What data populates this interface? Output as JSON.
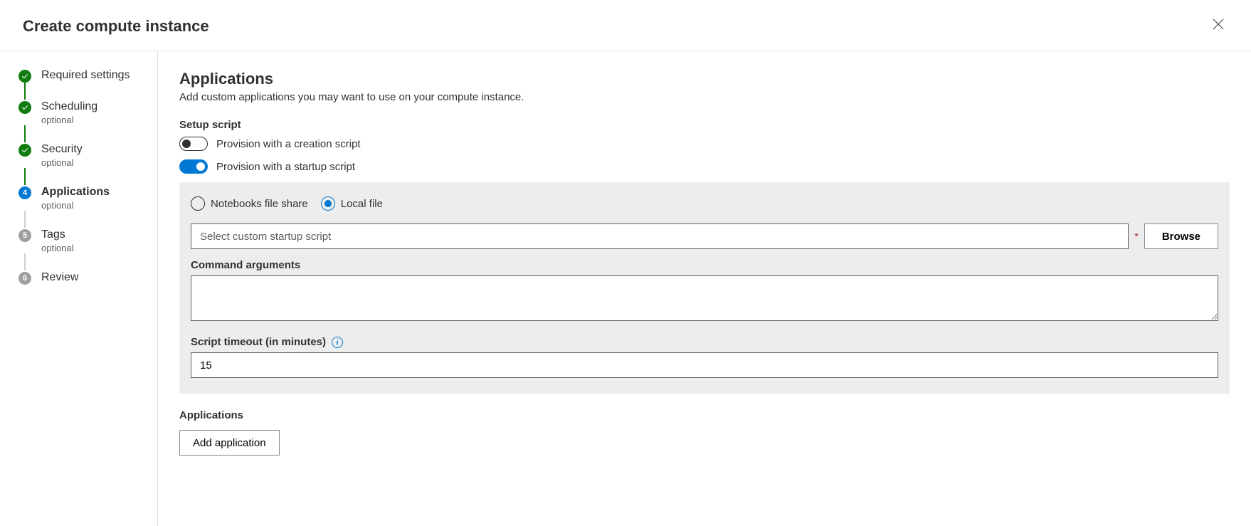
{
  "header": {
    "title": "Create compute instance"
  },
  "steps": [
    {
      "title": "Required settings",
      "sub": "",
      "state": "done"
    },
    {
      "title": "Scheduling",
      "sub": "optional",
      "state": "done"
    },
    {
      "title": "Security",
      "sub": "optional",
      "state": "done"
    },
    {
      "title": "Applications",
      "sub": "optional",
      "state": "current",
      "num": "4"
    },
    {
      "title": "Tags",
      "sub": "optional",
      "state": "pending",
      "num": "5"
    },
    {
      "title": "Review",
      "sub": "",
      "state": "pending",
      "num": "6"
    }
  ],
  "main": {
    "title": "Applications",
    "desc": "Add custom applications you may want to use on your compute instance.",
    "setup_label": "Setup script",
    "toggle_creation": "Provision with a creation script",
    "toggle_startup": "Provision with a startup script",
    "radio_notebooks": "Notebooks file share",
    "radio_local": "Local file",
    "script_placeholder": "Select custom startup script",
    "browse": "Browse",
    "cmd_args_label": "Command arguments",
    "cmd_args_value": "",
    "timeout_label": "Script timeout (in minutes)",
    "timeout_value": "15",
    "apps_label": "Applications",
    "add_app": "Add application"
  }
}
